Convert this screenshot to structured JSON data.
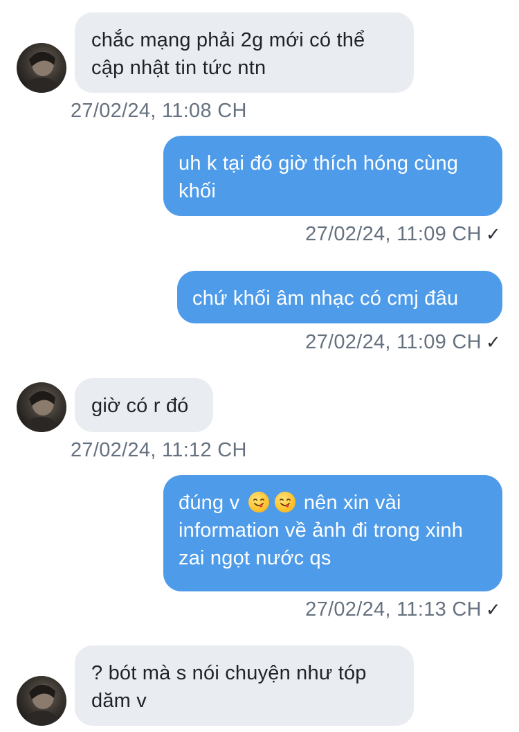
{
  "messages": [
    {
      "dir": "in",
      "text": "chắc mạng phải 2g mới có thể cập nhật tin tức ntn",
      "time": "27/02/24, 11:08 CH"
    },
    {
      "dir": "out",
      "text": "uh k tại đó giờ thích hóng cùng khối",
      "time": "27/02/24, 11:09 CH"
    },
    {
      "dir": "out",
      "text": "chứ khối âm nhạc có cmj đâu",
      "time": "27/02/24, 11:09 CH"
    },
    {
      "dir": "in",
      "text": "giờ có r đó",
      "time": "27/02/24, 11:12 CH"
    },
    {
      "dir": "out",
      "text_prefix": "đúng v",
      "emoji": "yum-face-emoji",
      "text_suffix": "nên xin vài information về ảnh đi trong xinh zai ngọt nước qs",
      "time": "27/02/24, 11:13 CH"
    },
    {
      "dir": "in",
      "text": "? bót mà s nói chuyện như tóp dăm v"
    }
  ],
  "read_mark": "✓",
  "colors": {
    "incoming_bubble": "#e9ecf1",
    "outgoing_bubble": "#4d9be9",
    "timestamp": "#66717f"
  }
}
